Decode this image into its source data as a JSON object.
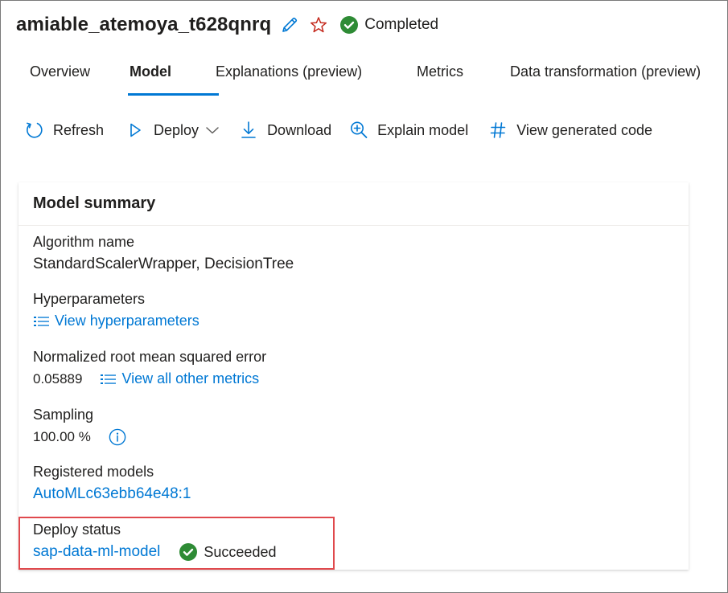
{
  "header": {
    "run_name": "amiable_atemoya_t628qnrq",
    "status": "Completed",
    "icons": {
      "edit": "pencil-icon",
      "favorite": "star-icon",
      "status": "check-circle-icon"
    },
    "colors": {
      "success": "#2e8b35",
      "star": "#c4281c",
      "accent": "#0078d4"
    }
  },
  "tabs": [
    {
      "label": "Overview",
      "active": false
    },
    {
      "label": "Model",
      "active": true
    },
    {
      "label": "Explanations (preview)",
      "active": false
    },
    {
      "label": "Metrics",
      "active": false
    },
    {
      "label": "Data transformation (preview)",
      "active": false
    }
  ],
  "toolbar": {
    "refresh": "Refresh",
    "deploy": "Deploy",
    "download": "Download",
    "explain": "Explain model",
    "view_code": "View generated code"
  },
  "summary": {
    "title": "Model summary",
    "algorithm_label": "Algorithm name",
    "algorithm_value": "StandardScalerWrapper, DecisionTree",
    "hyper_label": "Hyperparameters",
    "hyper_link": "View hyperparameters",
    "nrmse_label": "Normalized root mean squared error",
    "nrmse_value": "0.05889",
    "metrics_link": "View all other metrics",
    "sampling_label": "Sampling",
    "sampling_value": "100.00 %",
    "registered_label": "Registered models",
    "registered_value": "AutoMLc63ebb64e48:1",
    "deploy_label": "Deploy status",
    "deploy_value": "sap-data-ml-model",
    "deploy_status": "Succeeded"
  }
}
